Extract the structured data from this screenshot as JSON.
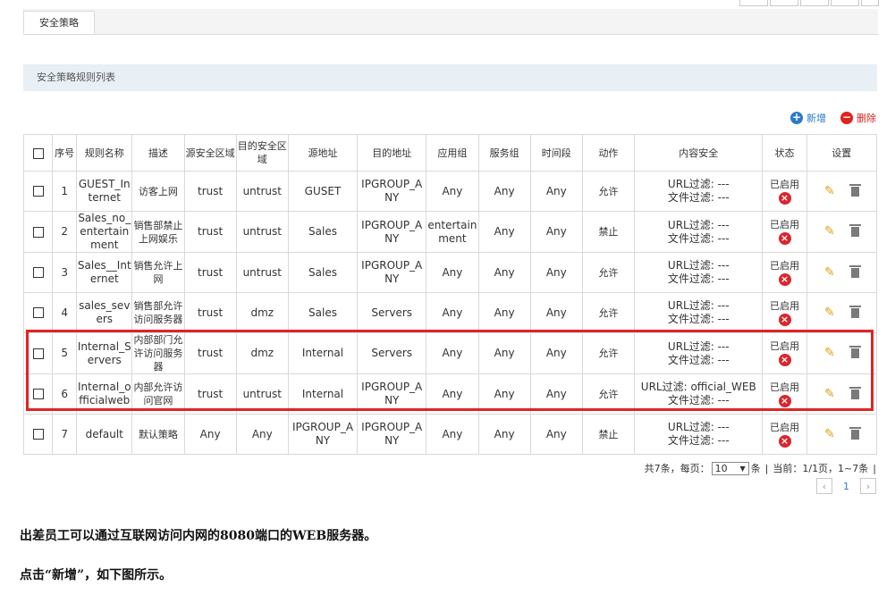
{
  "tab": "安全策略",
  "section_title": "安全策略规则列表",
  "actions": {
    "add": "新增",
    "delete": "删除"
  },
  "headers": [
    "序号",
    "规则名称",
    "描述",
    "源安全区域",
    "目的安全区域",
    "源地址",
    "目的地址",
    "应用组",
    "服务组",
    "时间段",
    "动作",
    "内容安全",
    "状态",
    "设置"
  ],
  "rows": [
    {
      "no": "1",
      "name": "GUEST_Internet",
      "desc": "访客上网",
      "src_zone": "trust",
      "dst_zone": "untrust",
      "src_addr": "GUSET",
      "dst_addr": "IPGROUP_ANY",
      "app": "Any",
      "service": "Any",
      "time": "Any",
      "action": "允许",
      "url": "URL过滤: ---",
      "file": "文件过滤: ---",
      "status": "已启用"
    },
    {
      "no": "2",
      "name": "Sales_no_entertainment",
      "desc": "销售部禁止上网娱乐",
      "src_zone": "trust",
      "dst_zone": "untrust",
      "src_addr": "Sales",
      "dst_addr": "IPGROUP_ANY",
      "app": "entertainment",
      "service": "Any",
      "time": "Any",
      "action": "禁止",
      "url": "URL过滤: ---",
      "file": "文件过滤: ---",
      "status": "已启用"
    },
    {
      "no": "3",
      "name": "Sales__Internet",
      "desc": "销售允许上网",
      "src_zone": "trust",
      "dst_zone": "untrust",
      "src_addr": "Sales",
      "dst_addr": "IPGROUP_ANY",
      "app": "Any",
      "service": "Any",
      "time": "Any",
      "action": "允许",
      "url": "URL过滤: ---",
      "file": "文件过滤: ---",
      "status": "已启用"
    },
    {
      "no": "4",
      "name": "sales_severs",
      "desc": "销售部允许访问服务器",
      "src_zone": "trust",
      "dst_zone": "dmz",
      "src_addr": "Sales",
      "dst_addr": "Servers",
      "app": "Any",
      "service": "Any",
      "time": "Any",
      "action": "允许",
      "url": "URL过滤: ---",
      "file": "文件过滤: ---",
      "status": "已启用"
    },
    {
      "no": "5",
      "name": "Internal_Servers",
      "desc": "内部部门允许访问服务器",
      "src_zone": "trust",
      "dst_zone": "dmz",
      "src_addr": "Internal",
      "dst_addr": "Servers",
      "app": "Any",
      "service": "Any",
      "time": "Any",
      "action": "允许",
      "url": "URL过滤: ---",
      "file": "文件过滤: ---",
      "status": "已启用"
    },
    {
      "no": "6",
      "name": "Internal_officialweb",
      "desc": "内部允许访问官网",
      "src_zone": "trust",
      "dst_zone": "untrust",
      "src_addr": "Internal",
      "dst_addr": "IPGROUP_ANY",
      "app": "Any",
      "service": "Any",
      "time": "Any",
      "action": "允许",
      "url": "URL过滤: official_WEB",
      "file": "文件过滤: ---",
      "status": "已启用"
    },
    {
      "no": "7",
      "name": "default",
      "desc": "默认策略",
      "src_zone": "Any",
      "dst_zone": "Any",
      "src_addr": "IPGROUP_ANY",
      "dst_addr": "IPGROUP_ANY",
      "app": "Any",
      "service": "Any",
      "time": "Any",
      "action": "禁止",
      "url": "URL过滤: ---",
      "file": "文件过滤: ---",
      "status": "已启用"
    }
  ],
  "pager": {
    "total": "共7条，每页：",
    "per_page": "10",
    "unit": "条",
    "sep1": "|",
    "current": "当前：1/1页，1~7条",
    "sep2": "|",
    "page": "1"
  },
  "notes": [
    "出差员工可以通过互联网访问内网的8080端口的WEB服务器。",
    "点击“新增”，如下图所示。"
  ]
}
